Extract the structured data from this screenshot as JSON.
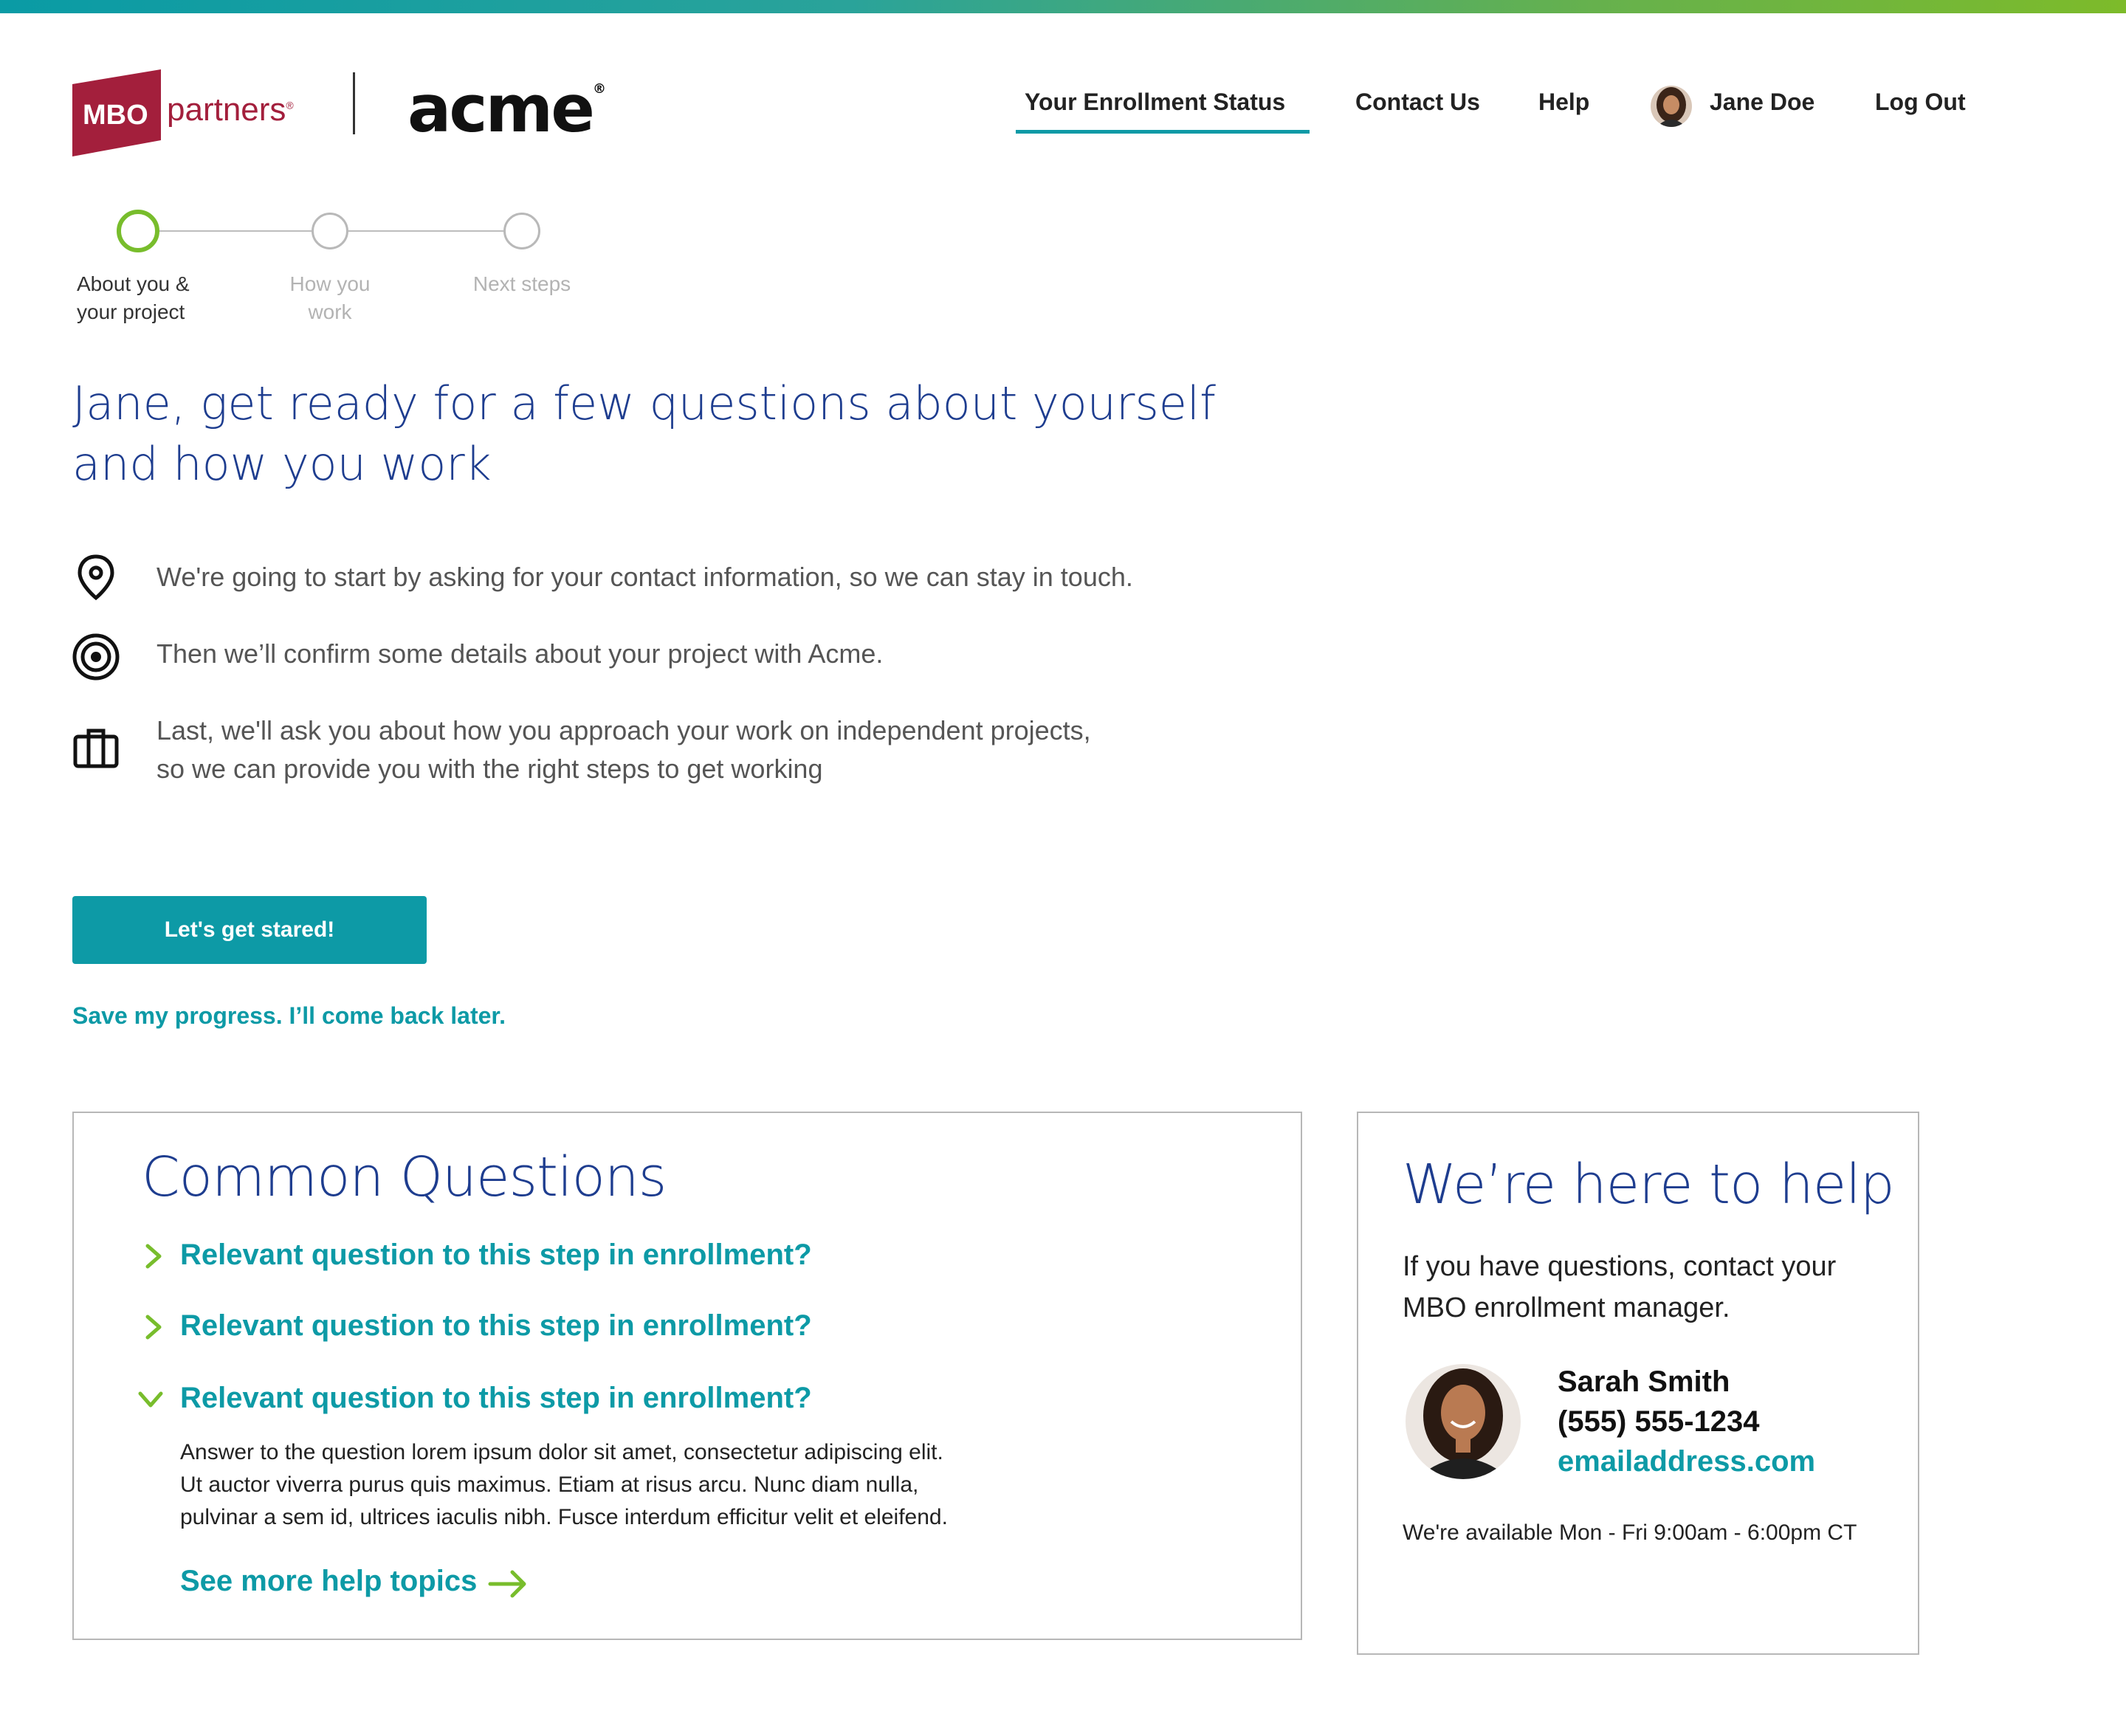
{
  "brand": {
    "mbo_logo_text": "MBO",
    "mbo_word": "partners",
    "client_logo": "acme",
    "colors": {
      "teal": "#0d9aa6",
      "green": "#78bd2c",
      "navy": "#1e3d8f",
      "mbo_red": "#a31f3c"
    }
  },
  "nav": {
    "items": [
      {
        "label": "Your Enrollment Status",
        "active": true
      },
      {
        "label": "Contact Us"
      },
      {
        "label": "Help"
      }
    ],
    "user_name": "Jane Doe",
    "logout": "Log Out"
  },
  "stepper": {
    "steps": [
      {
        "label_line1": "About you &",
        "label_line2": "your project",
        "active": true
      },
      {
        "label_line1": "How you",
        "label_line2": "work"
      },
      {
        "label_line1": "Next steps",
        "label_line2": ""
      }
    ]
  },
  "hero": {
    "title": "Jane, get ready for a few questions about yourself and how you work"
  },
  "info": [
    {
      "icon": "location-pin-icon",
      "line1": "We're going to start by asking for your contact information, so we can stay in touch.",
      "line2": ""
    },
    {
      "icon": "target-icon",
      "line1": "Then we’ll confirm some details about your project with Acme.",
      "line2": ""
    },
    {
      "icon": "briefcase-icon",
      "line1": "Last, we'll ask you about how you approach your work on independent projects,",
      "line2": "so we can provide you with the right steps to get working"
    }
  ],
  "cta": {
    "label": "Let's get stared!"
  },
  "save_link": "Save my progress. I’ll come back later.",
  "common_questions": {
    "title": "Common Questions",
    "questions": [
      {
        "text": "Relevant question to this step in enrollment?",
        "expanded": false
      },
      {
        "text": "Relevant question to this step in enrollment?",
        "expanded": false
      },
      {
        "text": "Relevant question to this step in enrollment?",
        "expanded": true
      }
    ],
    "answer_lines": [
      "Answer to the question lorem ipsum dolor sit amet, consectetur adipiscing elit.",
      "Ut auctor viverra purus quis maximus. Etiam at risus arcu. Nunc diam nulla,",
      "pulvinar a sem id, ultrices iaculis nibh. Fusce interdum efficitur velit et eleifend."
    ],
    "more_link": "See more help topics"
  },
  "help": {
    "title": "We’re here to help",
    "intro": "If you have questions, contact your MBO enrollment manager.",
    "name": "Sarah Smith",
    "phone": "(555) 555-1234",
    "email": "emailaddress.com",
    "hours": "We're available Mon - Fri 9:00am - 6:00pm CT"
  }
}
